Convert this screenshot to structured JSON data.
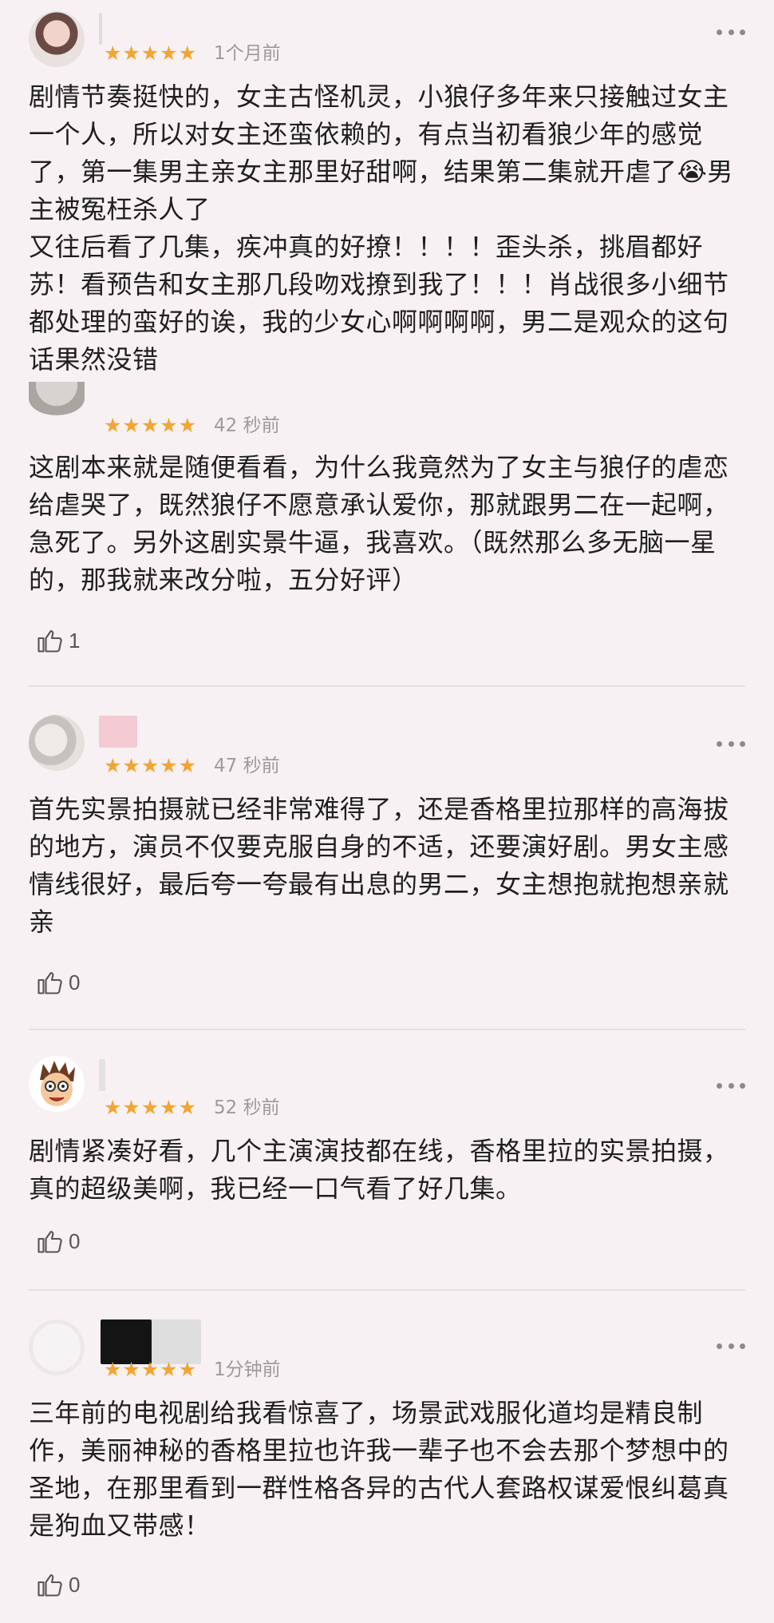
{
  "reviews": [
    {
      "stars": "★★★★★",
      "time": "1个月前",
      "text": "剧情节奏挺快的，女主古怪机灵，小狼仔多年来只接触过女主一个人，所以对女主还蛮依赖的，有点当初看狼少年的感觉了，第一集男主亲女主那里好甜啊，结果第二集就开虐了😭男主被冤枉杀人了\n又往后看了几集，疾冲真的好撩！！！！歪头杀，挑眉都好苏！看预告和女主那几段吻戏撩到我了！！！肖战很多小细节都处理的蛮好的诶，我的少女心啊啊啊啊，男二是观众的这句话果然没错"
    },
    {
      "stars": "★★★★★",
      "time": "42 秒前",
      "text": "这剧本来就是随便看看，为什么我竟然为了女主与狼仔的虐恋给虐哭了，既然狼仔不愿意承认爱你，那就跟男二在一起啊，急死了。另外这剧实景牛逼，我喜欢。（既然那么多无脑一星的，那我就来改分啦，五分好评）",
      "likes": "1"
    },
    {
      "stars": "★★★★★",
      "time": "47 秒前",
      "text": "首先实景拍摄就已经非常难得了，还是香格里拉那样的高海拔的地方，演员不仅要克服自身的不适，还要演好剧。男女主感情线很好，最后夸一夸最有出息的男二，女主想抱就抱想亲就亲",
      "likes": "0"
    },
    {
      "stars": "★★★★★",
      "time": "52 秒前",
      "text": "剧情紧凑好看，几个主演演技都在线，香格里拉的实景拍摄，真的超级美啊，我已经一口气看了好几集。",
      "likes": "0"
    },
    {
      "stars": "★★★★★",
      "time": "1分钟前",
      "text": "三年前的电视剧给我看惊喜了，场景武戏服化道均是精良制作，美丽神秘的香格里拉也许我一辈子也不会去那个梦想中的圣地，在那里看到一群性格各异的古代人套路权谋爱恨纠葛真是狗血又带感！",
      "likes": "0"
    }
  ],
  "colors": {
    "star": "#f2a531",
    "time": "#9c9a9b",
    "background": "#f7f1f3"
  },
  "icons": {
    "more": "more-dots-icon",
    "like": "thumbs-up-icon"
  }
}
